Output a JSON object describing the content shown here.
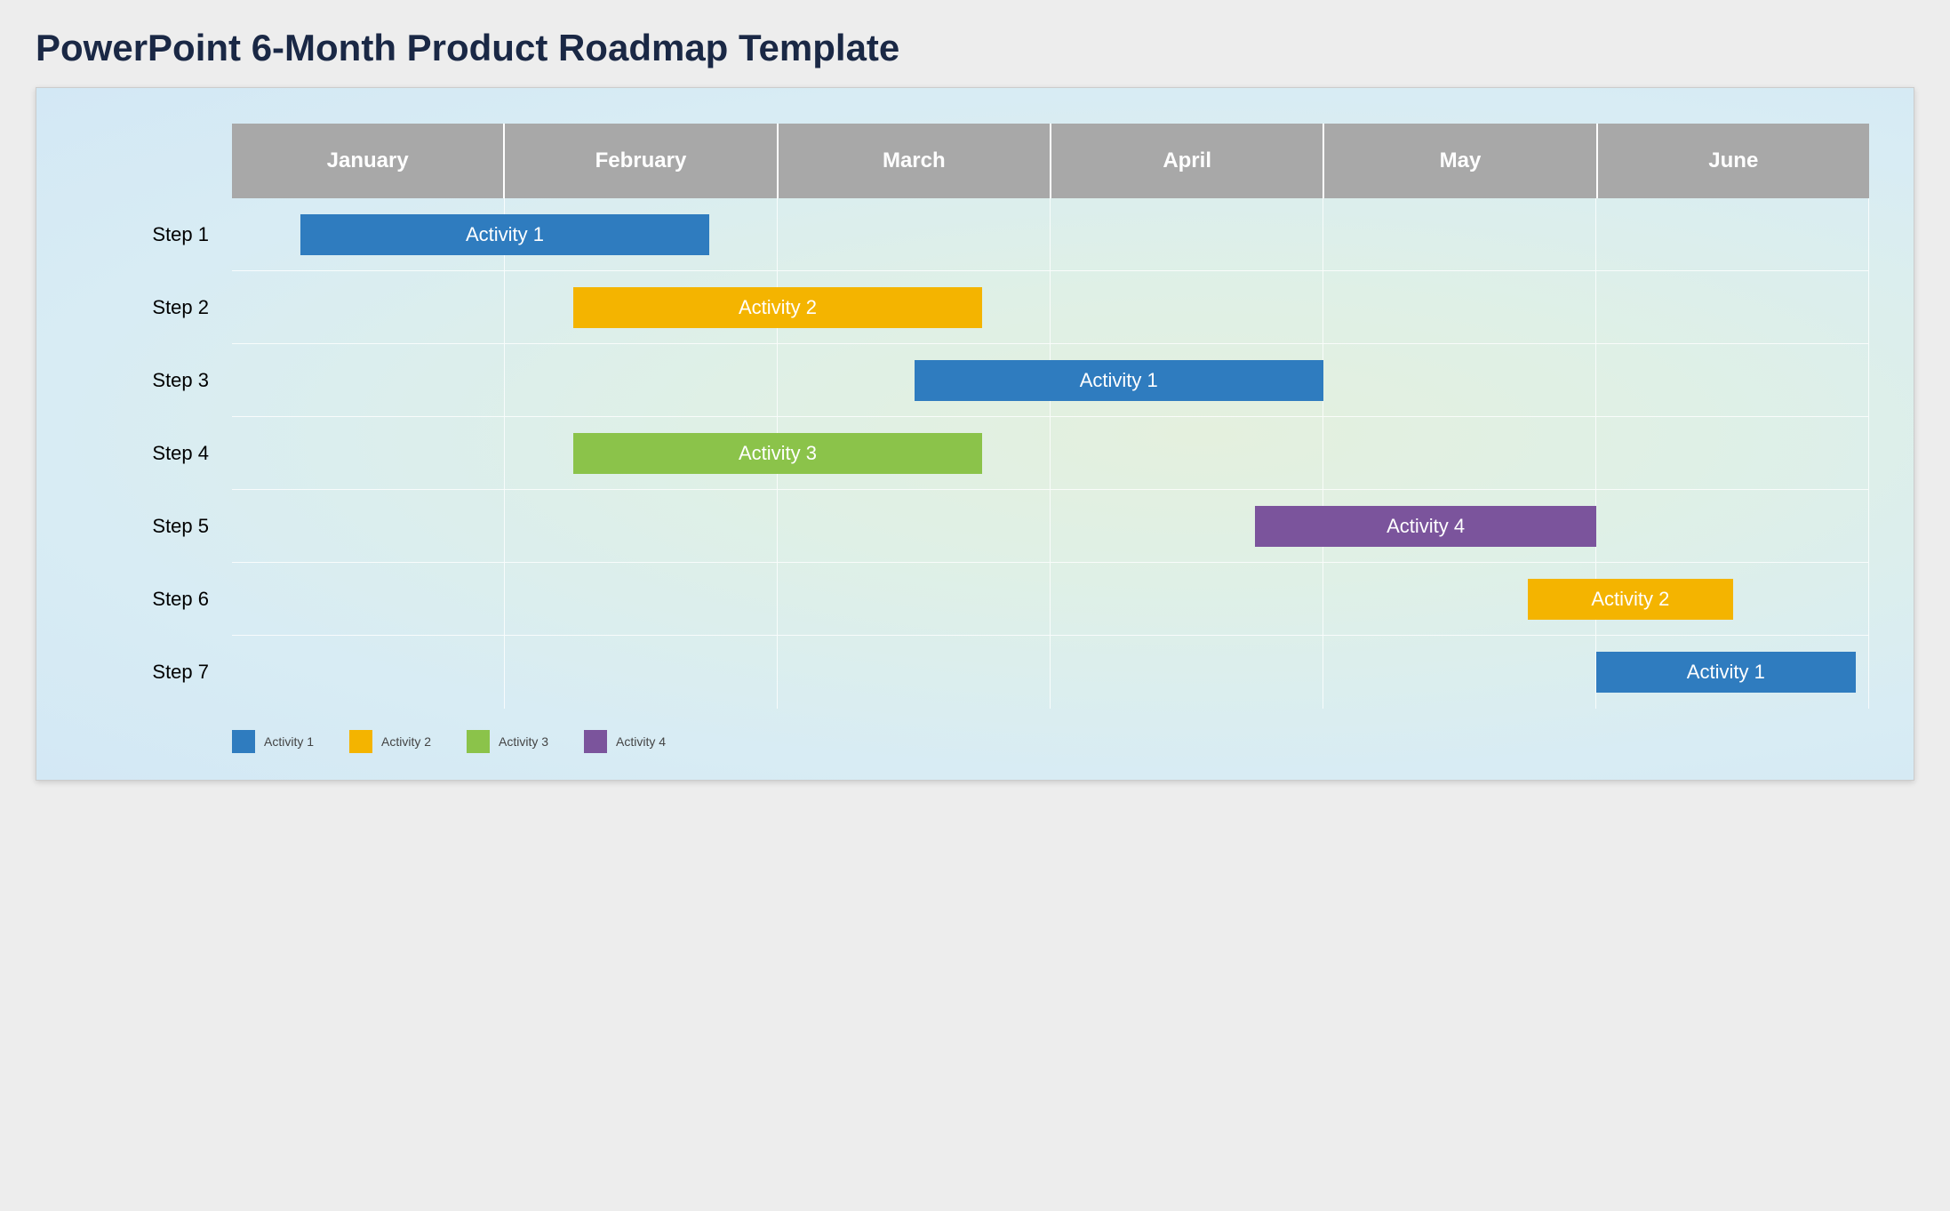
{
  "title": "PowerPoint 6-Month Product Roadmap Template",
  "chart_data": {
    "type": "bar",
    "title": "PowerPoint 6-Month Product Roadmap Template",
    "xlabel": "",
    "ylabel": "",
    "categories": [
      "January",
      "February",
      "March",
      "April",
      "May",
      "June"
    ],
    "rows": [
      "Step 1",
      "Step 2",
      "Step 3",
      "Step 4",
      "Step 5",
      "Step 6",
      "Step 7"
    ],
    "series": [
      {
        "row": "Step 1",
        "activity": "Activity 1",
        "start": 0.25,
        "end": 1.75,
        "color": "#2f7cbf"
      },
      {
        "row": "Step 2",
        "activity": "Activity 2",
        "start": 1.25,
        "end": 2.75,
        "color": "#f4b400"
      },
      {
        "row": "Step 3",
        "activity": "Activity 1",
        "start": 2.5,
        "end": 4.0,
        "color": "#2f7cbf"
      },
      {
        "row": "Step 4",
        "activity": "Activity 3",
        "start": 1.25,
        "end": 2.75,
        "color": "#8bc34a"
      },
      {
        "row": "Step 5",
        "activity": "Activity 4",
        "start": 3.75,
        "end": 5.0,
        "color": "#7b549c"
      },
      {
        "row": "Step 6",
        "activity": "Activity 2",
        "start": 4.75,
        "end": 5.5,
        "color": "#f4b400"
      },
      {
        "row": "Step 7",
        "activity": "Activity 1",
        "start": 5.0,
        "end": 5.95,
        "color": "#2f7cbf"
      }
    ],
    "legend": [
      {
        "label": "Activity 1",
        "color": "#2f7cbf"
      },
      {
        "label": "Activity 2",
        "color": "#f4b400"
      },
      {
        "label": "Activity 3",
        "color": "#8bc34a"
      },
      {
        "label": "Activity 4",
        "color": "#7b549c"
      }
    ]
  }
}
